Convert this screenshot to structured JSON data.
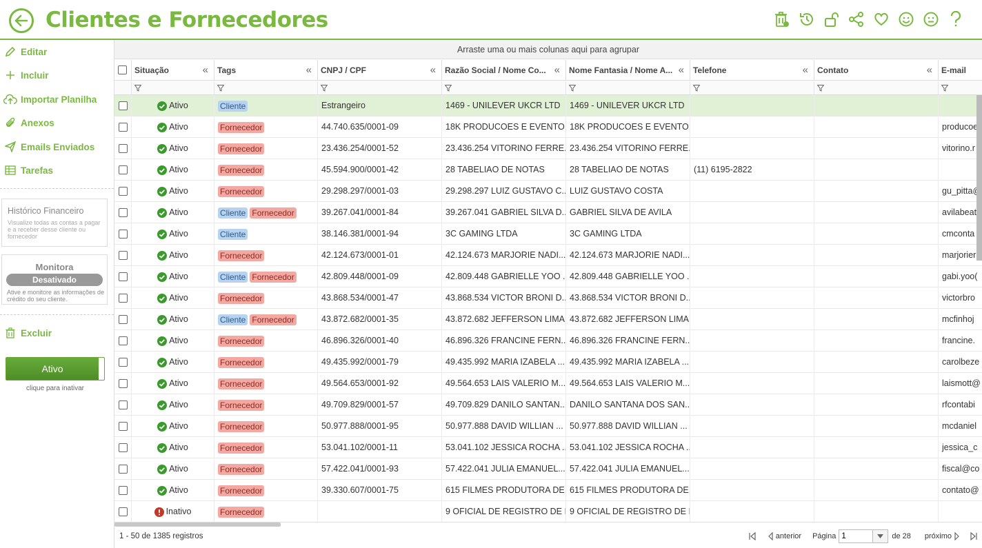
{
  "page_title": "Clientes e Fornecedores",
  "colors": {
    "accent": "#7ab940",
    "ok": "#3a9a2c",
    "error": "#c0392b",
    "selected_row": "#e1f1d5"
  },
  "top_icons": [
    "trash-icon",
    "history-icon",
    "unlock-icon",
    "share-icon",
    "heart-icon",
    "smile-icon",
    "neutral-face-icon",
    "help-icon"
  ],
  "sidebar": {
    "items": [
      {
        "label": "Editar",
        "icon": "pencil-icon"
      },
      {
        "label": "Incluir",
        "icon": "plus-icon"
      },
      {
        "label": "Importar Planilha",
        "icon": "cloud-upload-icon"
      },
      {
        "label": "Anexos",
        "icon": "paperclip-icon"
      },
      {
        "label": "Emails Enviados",
        "icon": "send-icon"
      },
      {
        "label": "Tarefas",
        "icon": "table-icon"
      }
    ],
    "historico": {
      "title": "Histórico Financeiro",
      "desc": "Visualize todas as contas a pagar e a receber desse cliente ou fornecedor"
    },
    "monitora": {
      "title": "Monitora",
      "status": "Desativado",
      "desc": "Ative e monitore as informações de crédito do seu cliente."
    },
    "delete_label": "Excluir",
    "toggle_label": "Ativo",
    "toggle_caption": "clique para inativar"
  },
  "grid": {
    "group_hint": "Arraste uma ou mais colunas aqui para agrupar",
    "columns": [
      "Situação",
      "Tags",
      "CNPJ / CPF",
      "Razão Social / Nome Co...",
      "Nome Fantasia / Nome A...",
      "Telefone",
      "Contato",
      "E-mail"
    ],
    "rows": [
      {
        "status": "Ativo",
        "tags": [
          "Cliente"
        ],
        "doc": "Estrangeiro",
        "razao": "1469 - UNILEVER UKCR LTD",
        "fantasia": "1469 - UNILEVER UKCR LTD",
        "telefone": "",
        "contato": "",
        "email": "",
        "selected": true
      },
      {
        "status": "Ativo",
        "tags": [
          "Fornecedor"
        ],
        "doc": "44.740.635/0001-09",
        "razao": "18K PRODUCOES E EVENTO...",
        "fantasia": "18K PRODUCOES E EVENTO...",
        "telefone": "",
        "contato": "",
        "email": "producoe"
      },
      {
        "status": "Ativo",
        "tags": [
          "Fornecedor"
        ],
        "doc": "23.436.254/0001-52",
        "razao": "23.436.254 VITORINO FERRE...",
        "fantasia": "23.436.254 VITORINO FERRE...",
        "telefone": "",
        "contato": "",
        "email": "vitorino.r"
      },
      {
        "status": "Ativo",
        "tags": [
          "Fornecedor"
        ],
        "doc": "45.594.900/0001-42",
        "razao": "28 TABELIAO DE NOTAS",
        "fantasia": "28 TABELIAO DE NOTAS",
        "telefone": "(11) 6195-2822",
        "contato": "",
        "email": ""
      },
      {
        "status": "Ativo",
        "tags": [
          "Fornecedor"
        ],
        "doc": "29.298.297/0001-03",
        "razao": "29.298.297 LUIZ GUSTAVO C...",
        "fantasia": "LUIZ GUSTAVO COSTA",
        "telefone": "",
        "contato": "",
        "email": "gu_pitta@"
      },
      {
        "status": "Ativo",
        "tags": [
          "Cliente",
          "Fornecedor"
        ],
        "doc": "39.267.041/0001-84",
        "razao": "39.267.041 GABRIEL SILVA D...",
        "fantasia": "GABRIEL SILVA DE AVILA",
        "telefone": "",
        "contato": "",
        "email": "avilabeat"
      },
      {
        "status": "Ativo",
        "tags": [
          "Cliente"
        ],
        "doc": "38.146.381/0001-94",
        "razao": "3C GAMING LTDA",
        "fantasia": "3C GAMING LTDA",
        "telefone": "",
        "contato": "",
        "email": "cmconta"
      },
      {
        "status": "Ativo",
        "tags": [
          "Fornecedor"
        ],
        "doc": "42.124.673/0001-01",
        "razao": "42.124.673 MARJORIE NADI...",
        "fantasia": "42.124.673 MARJORIE NADI...",
        "telefone": "",
        "contato": "",
        "email": "marjorier"
      },
      {
        "status": "Ativo",
        "tags": [
          "Cliente",
          "Fornecedor"
        ],
        "doc": "42.809.448/0001-09",
        "razao": "42.809.448 GABRIELLE YOO ...",
        "fantasia": "42.809.448 GABRIELLE YOO ...",
        "telefone": "",
        "contato": "",
        "email": "gabi.yoo("
      },
      {
        "status": "Ativo",
        "tags": [
          "Fornecedor"
        ],
        "doc": "43.868.534/0001-47",
        "razao": "43.868.534 VICTOR BRONI D...",
        "fantasia": "43.868.534 VICTOR BRONI D...",
        "telefone": "",
        "contato": "",
        "email": "victorbro"
      },
      {
        "status": "Ativo",
        "tags": [
          "Cliente",
          "Fornecedor"
        ],
        "doc": "43.872.682/0001-35",
        "razao": "43.872.682 JEFFERSON LIMA...",
        "fantasia": "43.872.682 JEFFERSON LIMA...",
        "telefone": "",
        "contato": "",
        "email": "mcfinhoj"
      },
      {
        "status": "Ativo",
        "tags": [
          "Fornecedor"
        ],
        "doc": "46.896.326/0001-40",
        "razao": "46.896.326 FRANCINE FERN...",
        "fantasia": "46.896.326 FRANCINE FERN...",
        "telefone": "",
        "contato": "",
        "email": "francine."
      },
      {
        "status": "Ativo",
        "tags": [
          "Fornecedor"
        ],
        "doc": "49.435.992/0001-79",
        "razao": "49.435.992 MARIA IZABELA ...",
        "fantasia": "49.435.992 MARIA IZABELA ...",
        "telefone": "",
        "contato": "",
        "email": "carolbeze"
      },
      {
        "status": "Ativo",
        "tags": [
          "Fornecedor"
        ],
        "doc": "49.564.653/0001-92",
        "razao": "49.564.653 LAIS VALERIO M...",
        "fantasia": "49.564.653 LAIS VALERIO M...",
        "telefone": "",
        "contato": "",
        "email": "laismott@"
      },
      {
        "status": "Ativo",
        "tags": [
          "Fornecedor"
        ],
        "doc": "49.709.829/0001-57",
        "razao": "49.709.829 DANILO SANTAN...",
        "fantasia": "DANILO SANTANA DOS SAN...",
        "telefone": "",
        "contato": "",
        "email": "rfcontabi"
      },
      {
        "status": "Ativo",
        "tags": [
          "Fornecedor"
        ],
        "doc": "50.977.888/0001-95",
        "razao": "50.977.888 DAVID WILLIAN ...",
        "fantasia": "50.977.888 DAVID WILLIAN ...",
        "telefone": "",
        "contato": "",
        "email": "mcdaniel"
      },
      {
        "status": "Ativo",
        "tags": [
          "Fornecedor"
        ],
        "doc": "53.041.102/0001-11",
        "razao": "53.041.102 JESSICA ROCHA ...",
        "fantasia": "53.041.102 JESSICA ROCHA ...",
        "telefone": "",
        "contato": "",
        "email": "jessica_c"
      },
      {
        "status": "Ativo",
        "tags": [
          "Fornecedor"
        ],
        "doc": "57.422.041/0001-93",
        "razao": "57.422.041 JULIA EMANUEL...",
        "fantasia": "57.422.041 JULIA EMANUEL...",
        "telefone": "",
        "contato": "",
        "email": "fiscal@co"
      },
      {
        "status": "Ativo",
        "tags": [
          "Fornecedor"
        ],
        "doc": "39.330.607/0001-75",
        "razao": "615 FILMES PRODUTORA DE...",
        "fantasia": "615 FILMES PRODUTORA DE...",
        "telefone": "",
        "contato": "",
        "email": "contato@"
      },
      {
        "status": "Inativo",
        "tags": [
          "Fornecedor"
        ],
        "doc": "",
        "razao": "9 OFICIAL DE REGISTRO DE I...",
        "fantasia": "9 OFICIAL DE REGISTRO DE I...",
        "telefone": "",
        "contato": "",
        "email": ""
      }
    ]
  },
  "footer": {
    "records": "1 - 50 de 1385 registros",
    "prev": "anterior",
    "page_label": "Página",
    "page_value": "1",
    "total_pages": "de 28",
    "next": "próximo"
  }
}
